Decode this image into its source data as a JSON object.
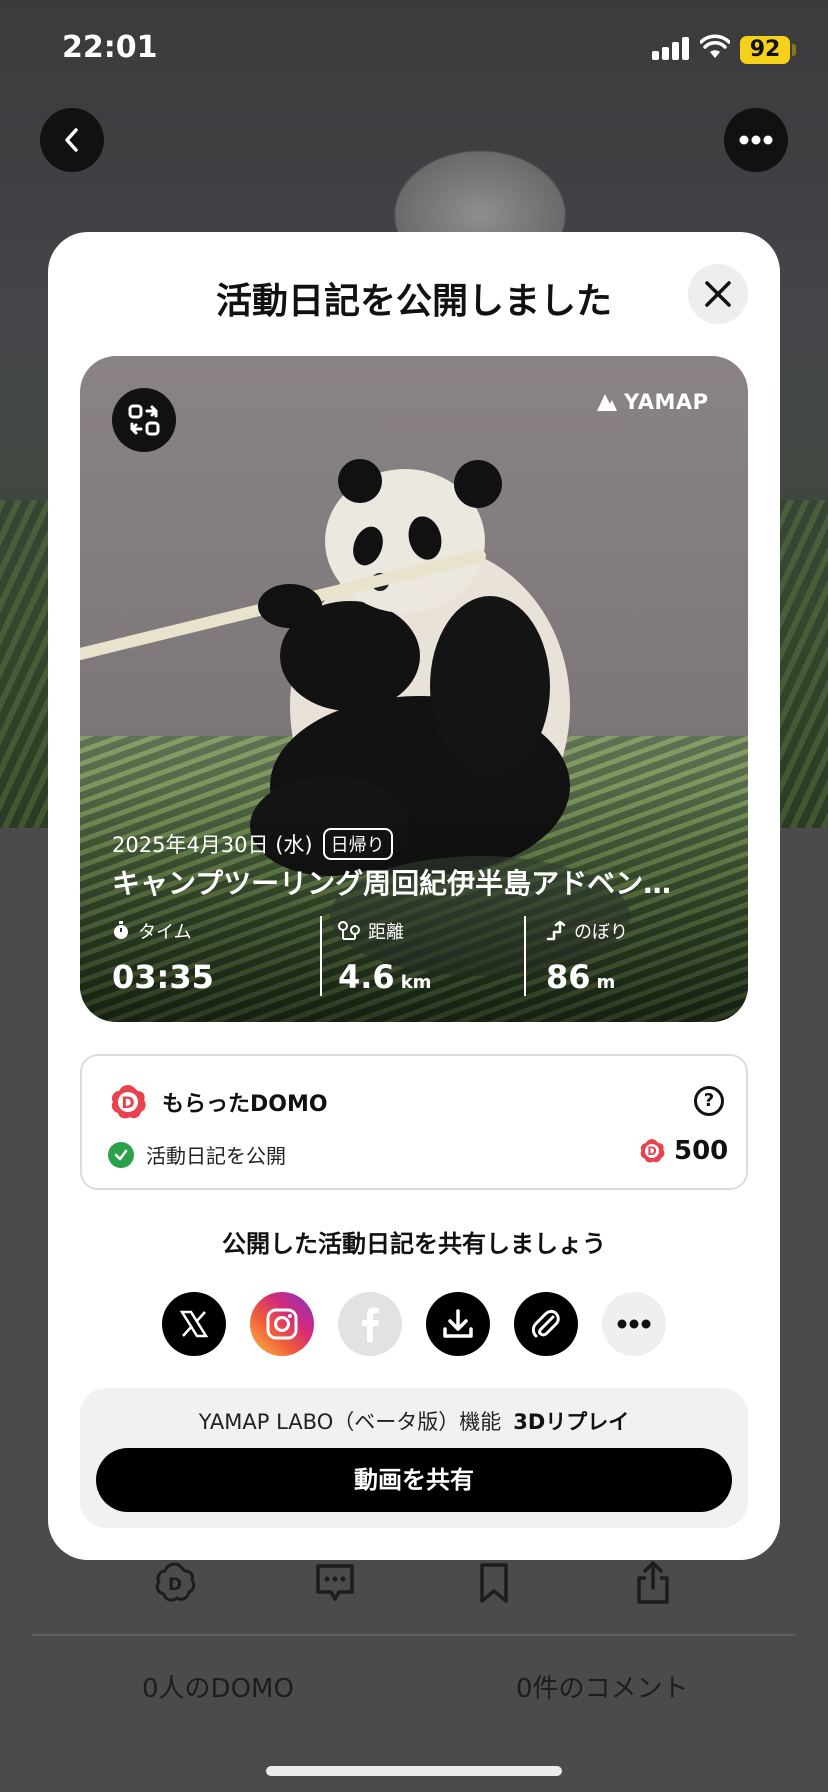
{
  "status_bar": {
    "time": "22:01",
    "battery": "92"
  },
  "background": {
    "domo_count": "0人のDOMO",
    "comment_count": "0件のコメント"
  },
  "modal": {
    "title": "活動日記を公開しました",
    "card": {
      "brand": "YAMAP",
      "date": "2025年4月30日 (水)",
      "day_badge": "日帰り",
      "title": "キャンプツーリング周回紀伊半島アドベン…",
      "stats": [
        {
          "label": "タイム",
          "value": "03:35",
          "unit": ""
        },
        {
          "label": "距離",
          "value": "4.6",
          "unit": "km"
        },
        {
          "label": "のぼり",
          "value": "86",
          "unit": "m"
        }
      ]
    },
    "domo": {
      "heading": "もらったDOMO",
      "row_label": "活動日記を公開",
      "amount": "500"
    },
    "share": {
      "heading": "公開した活動日記を共有しましょう"
    },
    "labo": {
      "label": "YAMAP LABO（ベータ版）機能",
      "feature": "3Dリプレイ",
      "button": "動画を共有"
    }
  },
  "colors": {
    "brand_red": "#e8424f",
    "check_green": "#2aa14a",
    "battery_yellow": "#f5d11a"
  }
}
